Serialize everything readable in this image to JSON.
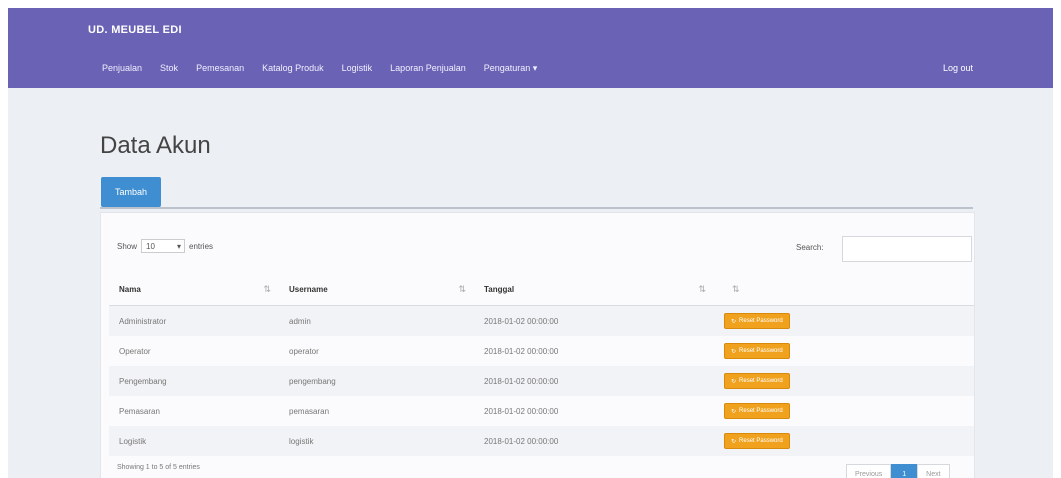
{
  "navbar": {
    "brand": "UD. MEUBEL EDI",
    "menu": [
      "Penjualan",
      "Stok",
      "Pemesanan",
      "Katalog Produk",
      "Logistik",
      "Laporan Penjualan",
      "Pengaturan ▾"
    ],
    "logout": "Log out"
  },
  "page": {
    "title": "Data Akun"
  },
  "toolbar": {
    "add_label": "Tambah"
  },
  "table_controls": {
    "show_label": "Show",
    "entries_value": "10",
    "entries_label": "entries",
    "search_label": "Search:",
    "search_value": ""
  },
  "table": {
    "columns": [
      "Nama",
      "Username",
      "Tanggal",
      ""
    ],
    "rows": [
      {
        "nama": "Administrator",
        "username": "admin",
        "tanggal": "2018-01-02 00:00:00",
        "action": "Reset Password"
      },
      {
        "nama": "Operator",
        "username": "operator",
        "tanggal": "2018-01-02 00:00:00",
        "action": "Reset Password"
      },
      {
        "nama": "Pengembang",
        "username": "pengembang",
        "tanggal": "2018-01-02 00:00:00",
        "action": "Reset Password"
      },
      {
        "nama": "Pemasaran",
        "username": "pemasaran",
        "tanggal": "2018-01-02 00:00:00",
        "action": "Reset Password"
      },
      {
        "nama": "Logistik",
        "username": "logistik",
        "tanggal": "2018-01-02 00:00:00",
        "action": "Reset Password"
      }
    ]
  },
  "footer": {
    "info": "Showing 1 to 5 of 5 entries",
    "pager": {
      "previous": "Previous",
      "current": "1",
      "next": "Next"
    }
  },
  "colors": {
    "navbar": "#6a63b5",
    "primary_button": "#3f8ed1",
    "warning_button": "#f0a21e",
    "background": "#eceff4"
  }
}
